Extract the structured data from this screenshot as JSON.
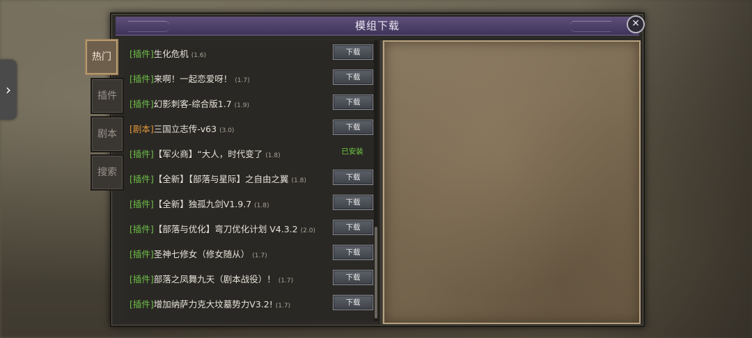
{
  "window": {
    "title": "模组下载",
    "close_icon": "close-icon"
  },
  "side_toggle": {
    "icon": "chevron-right-icon",
    "glyph": "›"
  },
  "tabs": [
    {
      "label": "热门",
      "active": true
    },
    {
      "label": "插件",
      "active": false
    },
    {
      "label": "剧本",
      "active": false
    },
    {
      "label": "搜索",
      "active": false
    }
  ],
  "download_label": "下载",
  "installed_label": "已安装",
  "items": [
    {
      "tag": "[插件]",
      "tag_type": "plugin",
      "name": "生化危机",
      "version": "(1.6)",
      "status": "download"
    },
    {
      "tag": "[插件]",
      "tag_type": "plugin",
      "name": "来啊！一起恋爱呀！",
      "version": "(1.7)",
      "status": "download"
    },
    {
      "tag": "[插件]",
      "tag_type": "plugin",
      "name": "幻影刺客-综合版1.7",
      "version": "(1.9)",
      "status": "download"
    },
    {
      "tag": "[剧本]",
      "tag_type": "script",
      "name": "三国立志传-v63",
      "version": "(3.0)",
      "status": "download"
    },
    {
      "tag": "[插件]",
      "tag_type": "plugin",
      "name": "【军火商】“大人，时代变了",
      "version": "(1.8)",
      "status": "installed"
    },
    {
      "tag": "[插件]",
      "tag_type": "plugin",
      "name": "【全新】【部落与星际】之自由之翼",
      "version": "(1.8)",
      "status": "download"
    },
    {
      "tag": "[插件]",
      "tag_type": "plugin",
      "name": "【全新】独孤九剑V1.9.7",
      "version": "(1.8)",
      "status": "download"
    },
    {
      "tag": "[插件]",
      "tag_type": "plugin",
      "name": "【部落与优化】弯刀优化计划 V4.3.2",
      "version": "(2.0)",
      "status": "download"
    },
    {
      "tag": "[插件]",
      "tag_type": "plugin",
      "name": "圣神七修女（修女随从）",
      "version": "(1.7)",
      "status": "download"
    },
    {
      "tag": "[插件]",
      "tag_type": "plugin",
      "name": "部落之凤舞九天（剧本战役）！",
      "version": "(1.7)",
      "status": "download"
    },
    {
      "tag": "[插件]",
      "tag_type": "plugin",
      "name": "增加纳萨力克大坟墓势力V3.2!",
      "version": "(1.7)",
      "status": "download"
    }
  ],
  "colors": {
    "plugin_tag": "#6fc24a",
    "script_tag": "#e0953a",
    "installed": "#6fd046",
    "title_bar": "#4e4268"
  }
}
